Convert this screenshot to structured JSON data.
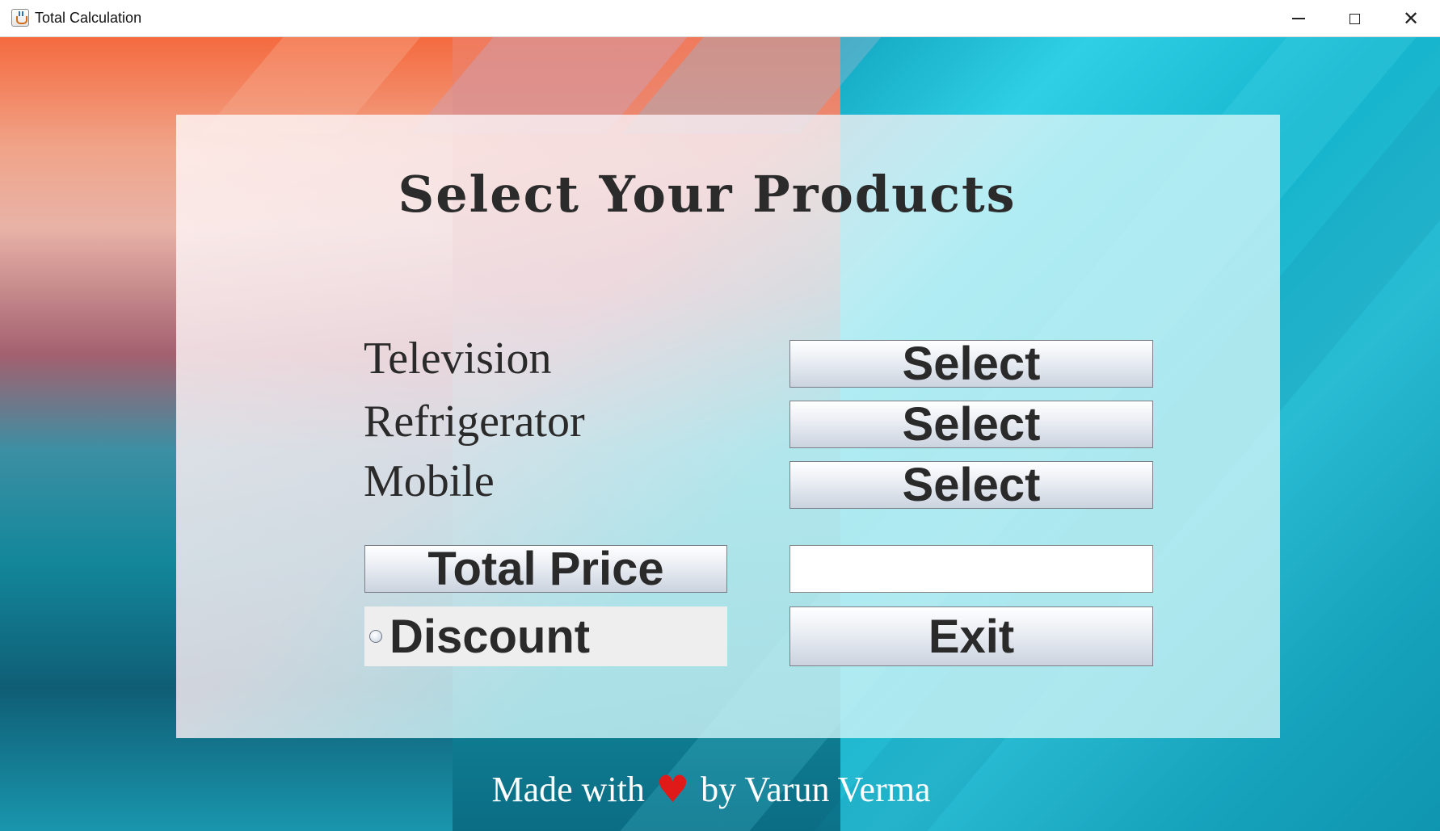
{
  "window": {
    "title": "Total Calculation"
  },
  "panel": {
    "title": "Select Your Products",
    "products": [
      {
        "label": "Television",
        "button_label": "Select"
      },
      {
        "label": "Refrigerator",
        "button_label": "Select"
      },
      {
        "label": "Mobile",
        "button_label": "Select"
      }
    ],
    "total_price_button": "Total Price",
    "total_price_value": "",
    "discount_label": "Discount",
    "discount_selected": false,
    "exit_button": "Exit"
  },
  "footer": {
    "prefix": "Made with",
    "heart_icon": "heart-icon",
    "suffix": "by Varun Verma"
  },
  "colors": {
    "heart": "#e01919",
    "button_text": "#2a2a2a"
  }
}
